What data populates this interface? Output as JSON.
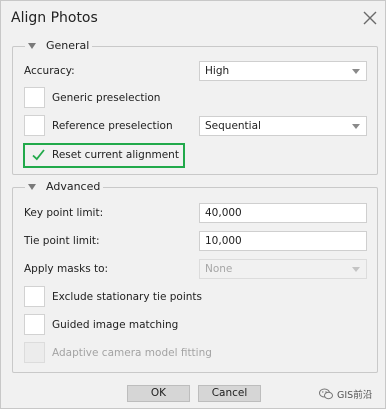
{
  "window": {
    "title": "Align Photos"
  },
  "general": {
    "header": "General",
    "accuracy": {
      "label": "Accuracy:",
      "value": "High"
    },
    "generic_preselection": {
      "label": "Generic preselection",
      "checked": false
    },
    "reference_preselection": {
      "label": "Reference preselection",
      "checked": false,
      "mode": "Sequential"
    },
    "reset_alignment": {
      "label": "Reset current alignment",
      "checked": true
    }
  },
  "advanced": {
    "header": "Advanced",
    "key_point_limit": {
      "label": "Key point limit:",
      "value": "40,000"
    },
    "tie_point_limit": {
      "label": "Tie point limit:",
      "value": "10,000"
    },
    "apply_masks": {
      "label": "Apply masks to:",
      "value": "None",
      "disabled": true
    },
    "exclude_stationary": {
      "label": "Exclude stationary tie points",
      "checked": false
    },
    "guided_matching": {
      "label": "Guided image matching",
      "checked": false
    },
    "adaptive_fitting": {
      "label": "Adaptive camera model fitting",
      "checked": false,
      "disabled": true
    }
  },
  "buttons": {
    "ok": "OK",
    "cancel": "Cancel"
  },
  "watermark": {
    "text": "GIS前沿",
    "icon": "wechat-icon"
  },
  "colors": {
    "highlight": "#21a94a",
    "check": "#21a94a"
  }
}
